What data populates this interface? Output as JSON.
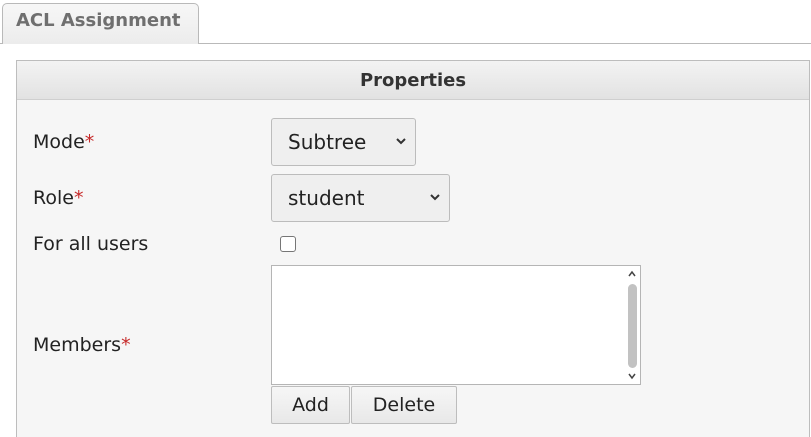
{
  "tab": {
    "label": "ACL Assignment"
  },
  "panel": {
    "title": "Properties"
  },
  "form": {
    "required_marker": "*",
    "mode": {
      "label": "Mode",
      "value": "Subtree"
    },
    "role": {
      "label": "Role",
      "value": "student"
    },
    "for_all_users": {
      "label": "For all users",
      "checked": false
    },
    "members": {
      "label": "Members",
      "items": []
    },
    "add_label": "Add",
    "delete_label": "Delete"
  },
  "colors": {
    "required": "#c62828"
  }
}
